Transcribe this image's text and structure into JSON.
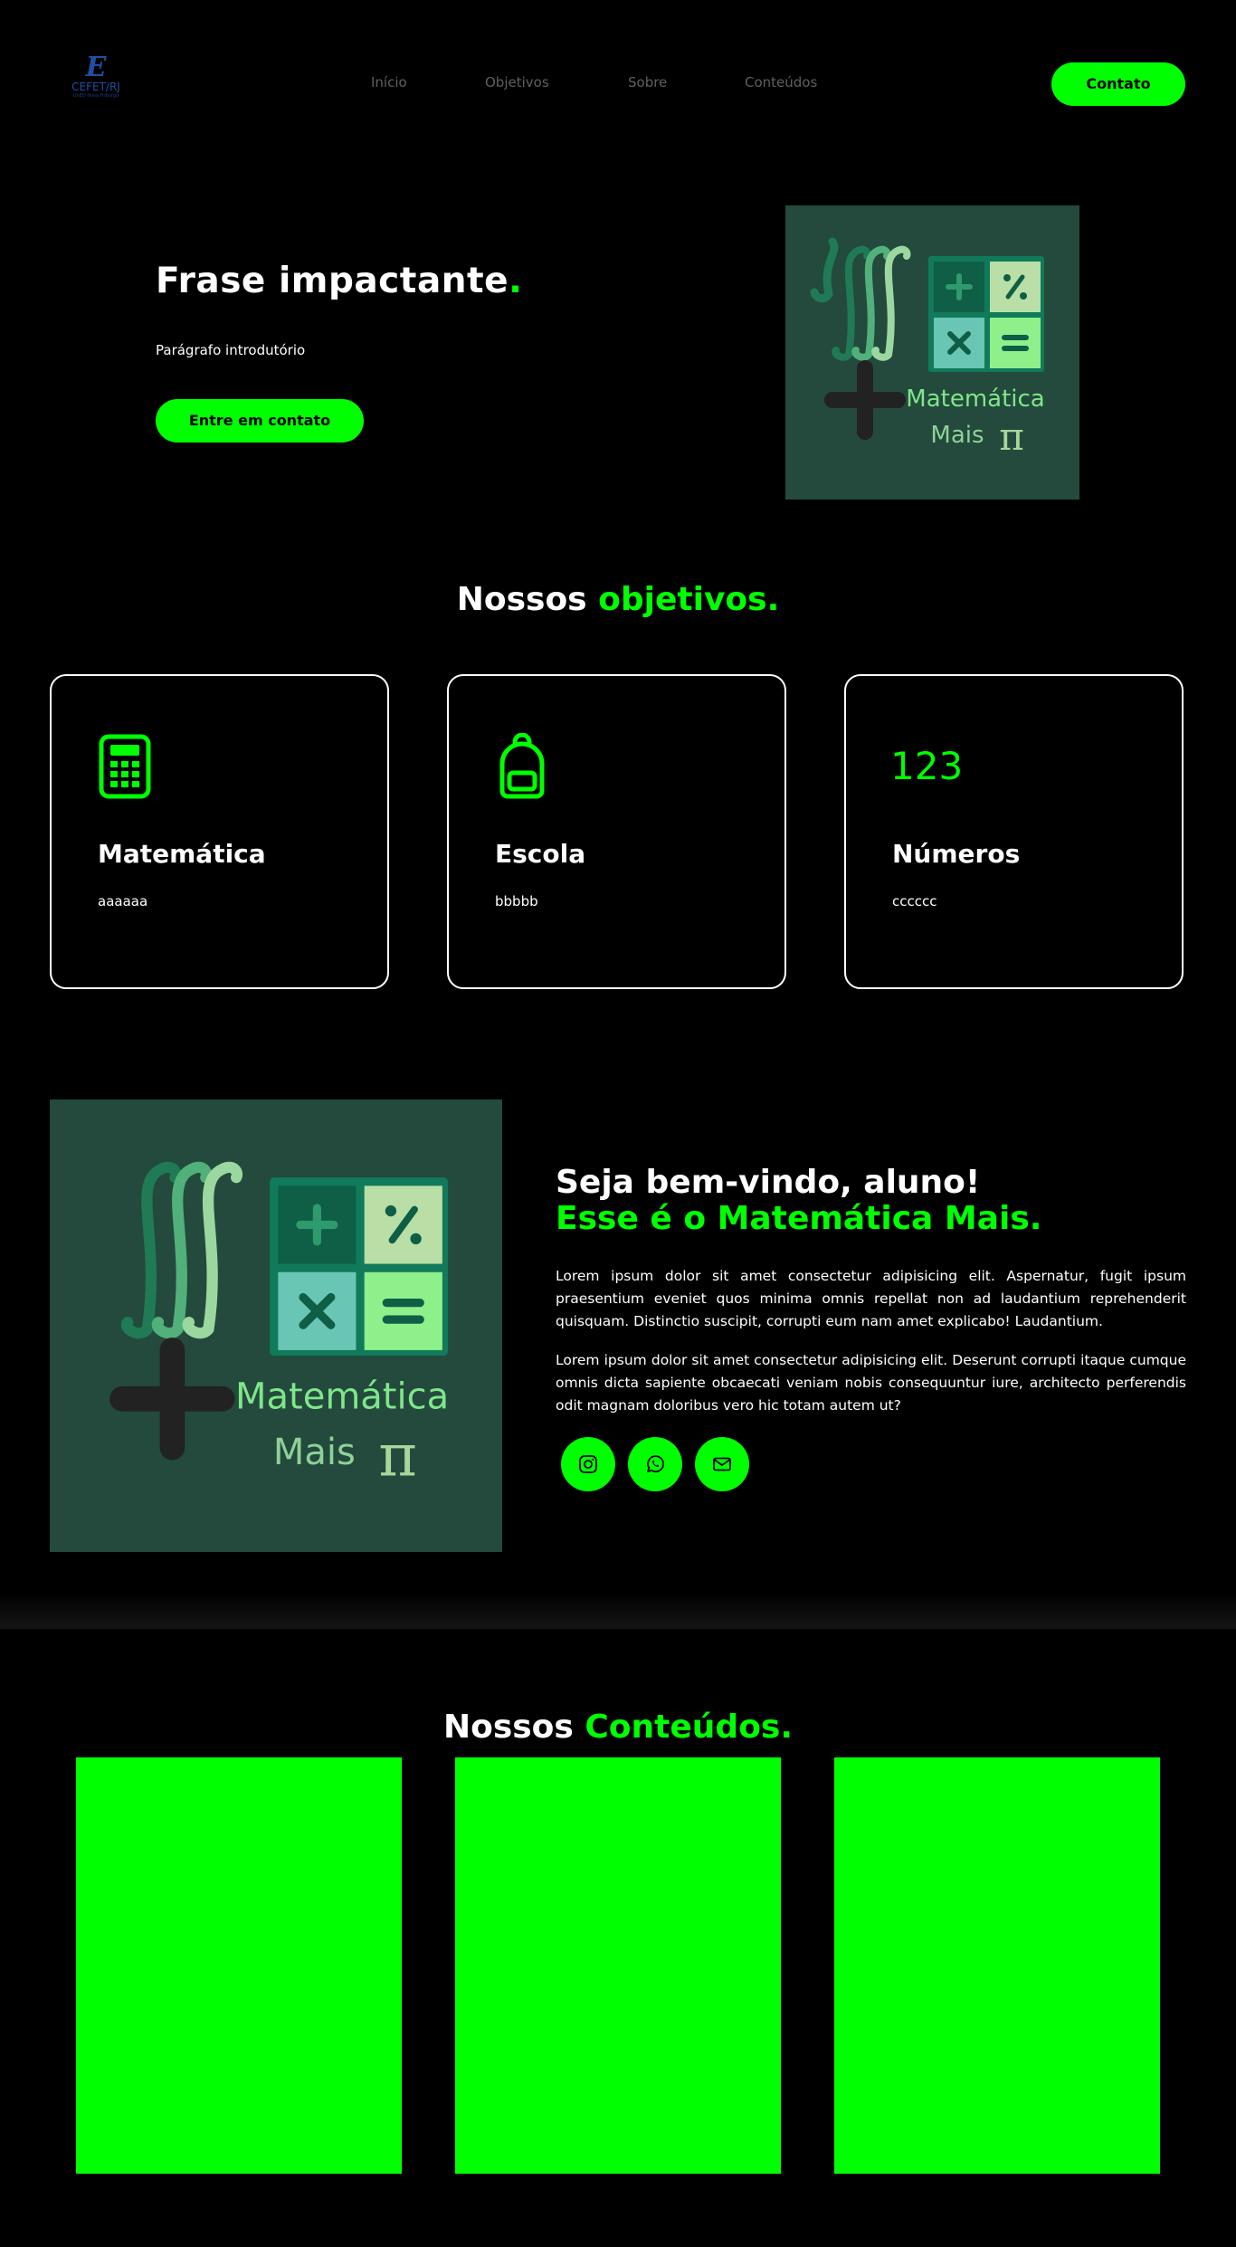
{
  "header": {
    "logo": {
      "mark": "E",
      "name": "CEFET/RJ",
      "tagline": "UnED Nova Friburgo",
      "icon": "cefet-logo-icon"
    },
    "nav": [
      "Início",
      "Objetivos",
      "Sobre",
      "Conteúdos"
    ],
    "contact_label": "Contato"
  },
  "hero": {
    "title": "Frase impactante",
    "title_dot": ".",
    "paragraph": "Parágrafo introdutório",
    "button_label": "Entre em contato",
    "image": {
      "line1": "Matemática",
      "line2": "Mais",
      "symbol": "π"
    }
  },
  "objectives": {
    "title_part1": "Nossos ",
    "title_part2": "objetivos.",
    "cards": [
      {
        "icon": "calculator-icon",
        "title": "Matemática",
        "text": "aaaaaa"
      },
      {
        "icon": "backpack-icon",
        "title": "Escola",
        "text": "bbbbb"
      },
      {
        "icon": "numbers-icon",
        "icon_text": "123",
        "title": "Números",
        "text": "cccccc"
      }
    ]
  },
  "welcome": {
    "title": "Seja bem-vindo, aluno!",
    "subtitle": "Esse é o Matemática Mais.",
    "paragraph1": "Lorem ipsum dolor sit amet consectetur adipisicing elit. Aspernatur, fugit ipsum praesentium eveniet quos minima omnis repellat non ad laudantium reprehenderit quisquam. Distinctio suscipit, corrupti eum nam amet explicabo! Laudantium.",
    "paragraph2": "Lorem ipsum dolor sit amet consectetur adipisicing elit. Deserunt corrupti itaque cumque omnis dicta sapiente obcaecati veniam nobis consequuntur iure, architecto perferendis odit magnam doloribus vero hic totam autem ut?",
    "image": {
      "line1": "Matemática",
      "line2": "Mais",
      "symbol": "π"
    },
    "social": [
      "instagram-icon",
      "whatsapp-icon",
      "email-icon"
    ]
  },
  "contents": {
    "title_part1": "Nossos ",
    "title_part2": "Conteúdos."
  },
  "colors": {
    "accent": "#00ff00",
    "background": "#000000",
    "image_bg": "#234a3c",
    "nav_text": "#5f5f5f"
  }
}
